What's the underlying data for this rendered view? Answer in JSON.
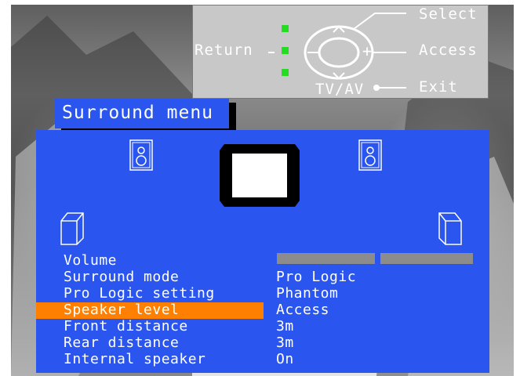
{
  "remote_help": {
    "select": "Select",
    "access": "Access",
    "exit": "Exit",
    "return": "Return",
    "tvav": "TV/AV",
    "plus": "+",
    "minus": "−"
  },
  "menu": {
    "title": "Surround menu",
    "items": [
      {
        "label": "Volume",
        "value": ""
      },
      {
        "label": "Surround mode",
        "value": "Pro Logic"
      },
      {
        "label": "Pro Logic setting",
        "value": "Phantom"
      },
      {
        "label": "Speaker level",
        "value": "Access",
        "selected": true
      },
      {
        "label": "Front distance",
        "value": "3m"
      },
      {
        "label": "Rear distance",
        "value": "3m"
      },
      {
        "label": "Internal speaker",
        "value": "On"
      }
    ]
  },
  "colors": {
    "panel": "#2a55ee",
    "highlight": "#ff8000",
    "led": "#22dd22"
  }
}
